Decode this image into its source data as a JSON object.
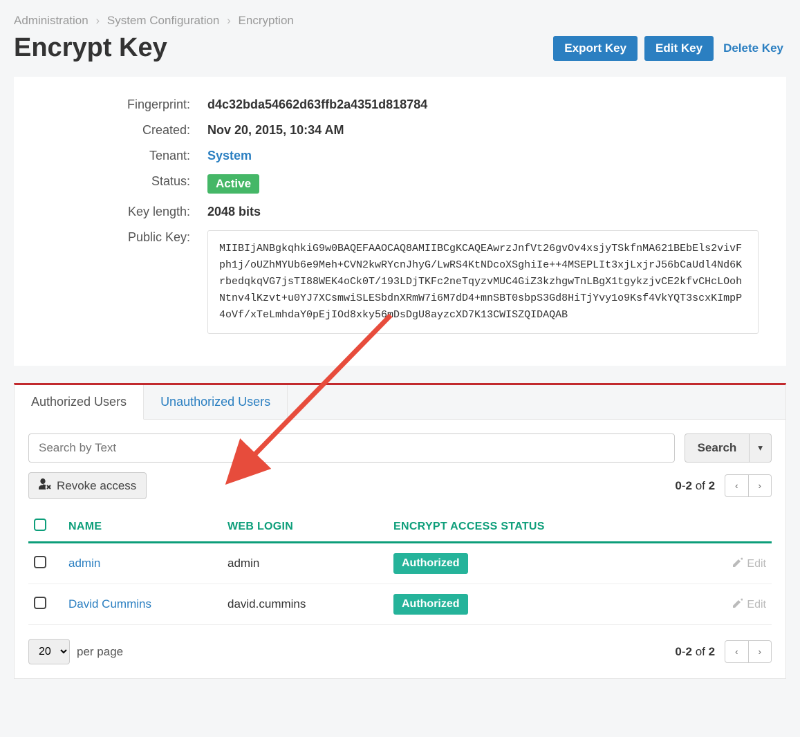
{
  "breadcrumb": {
    "item1": "Administration",
    "item2": "System Configuration",
    "item3": "Encryption"
  },
  "page_title": "Encrypt Key",
  "actions": {
    "export": "Export Key",
    "edit": "Edit Key",
    "delete": "Delete Key"
  },
  "details": {
    "fingerprint_label": "Fingerprint:",
    "fingerprint": "d4c32bda54662d63ffb2a4351d818784",
    "created_label": "Created:",
    "created": "Nov 20, 2015, 10:34 AM",
    "tenant_label": "Tenant:",
    "tenant": "System",
    "status_label": "Status:",
    "status": "Active",
    "key_length_label": "Key length:",
    "key_length": "2048 bits",
    "public_key_label": "Public Key:",
    "public_key": "MIIBIjANBgkqhkiG9w0BAQEFAAOCAQ8AMIIBCgKCAQEAwrzJnfVt26gvOv4xsjyTSkfnMA621BEbEls2vivFph1j/oUZhMYUb6e9Meh+CVN2kwRYcnJhyG/LwRS4KtNDcoXSghiIe++4MSEPLIt3xjLxjrJ56bCaUdl4Nd6KrbedqkqVG7jsTI88WEK4oCk0T/193LDjTKFc2neTqyzvMUC4GiZ3kzhgwTnLBgX1tgykzjvCE2kfvCHcLOohNtnv4lKzvt+u0YJ7XCsmwiSLESbdnXRmW7i6M7dD4+mnSBT0sbpS3Gd8HiTjYvy1o9Ksf4VkYQT3scxKImpP4oVf/xTeLmhdaY0pEjIOd8xky56mDsDgU8ayzcXD7K13CWISZQIDAQAB"
  },
  "tabs": {
    "authorized": "Authorized Users",
    "unauthorized": "Unauthorized Users"
  },
  "search": {
    "placeholder": "Search by Text",
    "button": "Search"
  },
  "revoke_label": "Revoke access",
  "pager": {
    "text": "0-2 of 2"
  },
  "table": {
    "headers": {
      "name": "NAME",
      "web_login": "WEB LOGIN",
      "status": "ENCRYPT ACCESS STATUS"
    },
    "rows": [
      {
        "name": "admin",
        "login": "admin",
        "status": "Authorized",
        "edit": "Edit"
      },
      {
        "name": "David Cummins",
        "login": "david.cummins",
        "status": "Authorized",
        "edit": "Edit"
      }
    ]
  },
  "per_page": {
    "value": "20",
    "label": "per page"
  }
}
